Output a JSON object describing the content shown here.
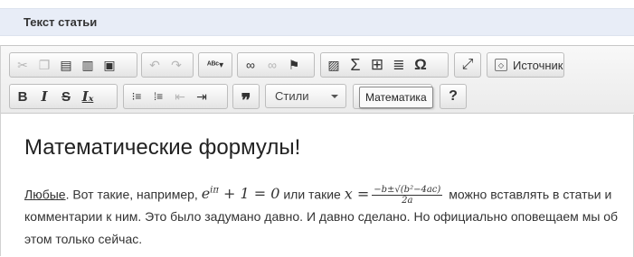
{
  "section": {
    "title": "Текст статьи"
  },
  "toolbar": {
    "row1": [
      {
        "name": "cut-icon",
        "glyph": "✂",
        "enabled": false
      },
      {
        "name": "copy-icon",
        "glyph": "⧉",
        "enabled": false
      },
      {
        "name": "paste-icon",
        "glyph": "📋",
        "enabled": true
      },
      {
        "name": "paste-text-icon",
        "glyph": "📋",
        "enabled": true
      },
      {
        "name": "paste-word-icon",
        "glyph": "📋",
        "enabled": true
      },
      {
        "name": "undo-icon",
        "glyph": "↶",
        "enabled": false
      },
      {
        "name": "redo-icon",
        "glyph": "↷",
        "enabled": false
      },
      {
        "name": "spellcheck-icon",
        "glyph": "ᴬᴮᶜ▾",
        "enabled": true
      },
      {
        "name": "link-icon",
        "glyph": "⛓",
        "enabled": true
      },
      {
        "name": "unlink-icon",
        "glyph": "⛓",
        "enabled": false
      },
      {
        "name": "anchor-flag-icon",
        "glyph": "⚑",
        "enabled": true
      },
      {
        "name": "image-icon",
        "glyph": "🖼",
        "enabled": true
      },
      {
        "name": "math-sigma-icon",
        "glyph": "Σ",
        "enabled": true
      },
      {
        "name": "table-icon",
        "glyph": "▦",
        "enabled": true
      },
      {
        "name": "horizontal-rule-icon",
        "glyph": "≣",
        "enabled": true
      },
      {
        "name": "special-char-omega-icon",
        "glyph": "Ω",
        "enabled": true
      },
      {
        "name": "maximize-icon",
        "glyph": "⤢",
        "enabled": true
      }
    ],
    "source_label": "Источник",
    "row2": [
      {
        "name": "bold-icon",
        "glyph": "B"
      },
      {
        "name": "italic-icon",
        "glyph": "I"
      },
      {
        "name": "strike-icon",
        "glyph": "S"
      },
      {
        "name": "remove-format-icon",
        "glyph": "Iₓ"
      },
      {
        "name": "numbered-list-icon",
        "glyph": "⒈≡"
      },
      {
        "name": "bulleted-list-icon",
        "glyph": "•≡"
      },
      {
        "name": "outdent-icon",
        "glyph": "⇤"
      },
      {
        "name": "indent-icon",
        "glyph": "⇥"
      },
      {
        "name": "blockquote-icon",
        "glyph": "❞"
      }
    ],
    "styles_label": "Стили",
    "tooltip": "Математика",
    "help_glyph": "?"
  },
  "content": {
    "heading": "Математические формулы!",
    "link_text": "Любые",
    "text_before_math": ". Вот такие, например,",
    "formula1": "e^{iπ} + 1 = 0",
    "text_between": "или такие",
    "formula2_lhs": "x =",
    "formula2_num": "−b±√(b²−4ac)",
    "formula2_den": "2a",
    "text_after": "можно вставлять в статьи и комментарии к ним. Это было задумано давно. И давно сделано. Но официально оповещаем мы об этом только сейчас."
  }
}
